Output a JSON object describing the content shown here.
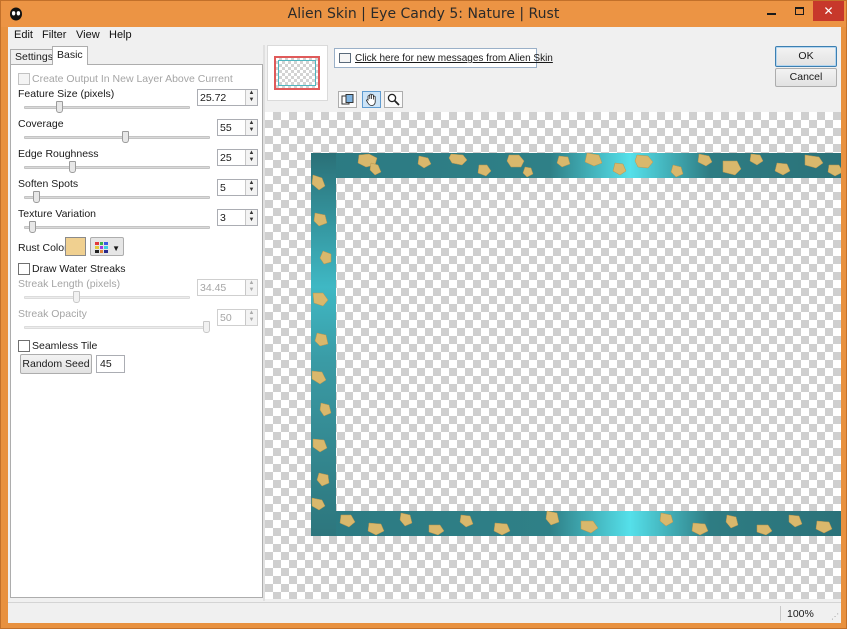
{
  "window": {
    "title": "Alien Skin | Eye Candy 5: Nature | Rust",
    "app_icon": "alien-head-icon",
    "controls": {
      "minimize": "–",
      "close": "✕"
    }
  },
  "menu": [
    "Edit",
    "Filter",
    "View",
    "Help"
  ],
  "tabs": {
    "settings": "Settings",
    "basic": "Basic",
    "active": "Basic"
  },
  "controls": {
    "create_output": {
      "label": "Create Output In New Layer Above Current",
      "checked": false,
      "enabled": false
    },
    "feature_size": {
      "label": "Feature Size (pixels)",
      "value": "25.72",
      "slider_fraction": 0.2
    },
    "coverage": {
      "label": "Coverage",
      "value": "55",
      "slider_fraction": 0.55
    },
    "edge_roughness": {
      "label": "Edge Roughness",
      "value": "25",
      "slider_fraction": 0.25
    },
    "soften_spots": {
      "label": "Soften Spots",
      "value": "5",
      "slider_fraction": 0.05
    },
    "texture_variation": {
      "label": "Texture Variation",
      "value": "3",
      "slider_fraction": 0.03
    },
    "rust_color": {
      "label": "Rust Color",
      "color": "#f0d090"
    },
    "draw_water_streaks": {
      "label": "Draw Water Streaks",
      "checked": false
    },
    "streak_length": {
      "label": "Streak Length (pixels)",
      "value": "34.45",
      "slider_fraction": 0.31,
      "enabled": false
    },
    "streak_opacity": {
      "label": "Streak Opacity",
      "value": "50",
      "slider_fraction": 1.0,
      "enabled": false
    },
    "seamless_tile": {
      "label": "Seamless Tile",
      "checked": false
    },
    "random_seed": {
      "button": "Random Seed",
      "value": "45"
    }
  },
  "message_link": "Click here for new messages from Alien Skin",
  "buttons": {
    "ok": "OK",
    "cancel": "Cancel"
  },
  "tools": [
    "preview-compare-icon",
    "hand-icon",
    "zoom-icon"
  ],
  "status": {
    "zoom": "100%"
  },
  "colors": {
    "title_bar": "#ec9444",
    "close_red": "#c7382b",
    "frame_teal": "#2e7f86",
    "frame_cyan": "#4fd6e0",
    "rust_gold": "#d8b66a"
  }
}
